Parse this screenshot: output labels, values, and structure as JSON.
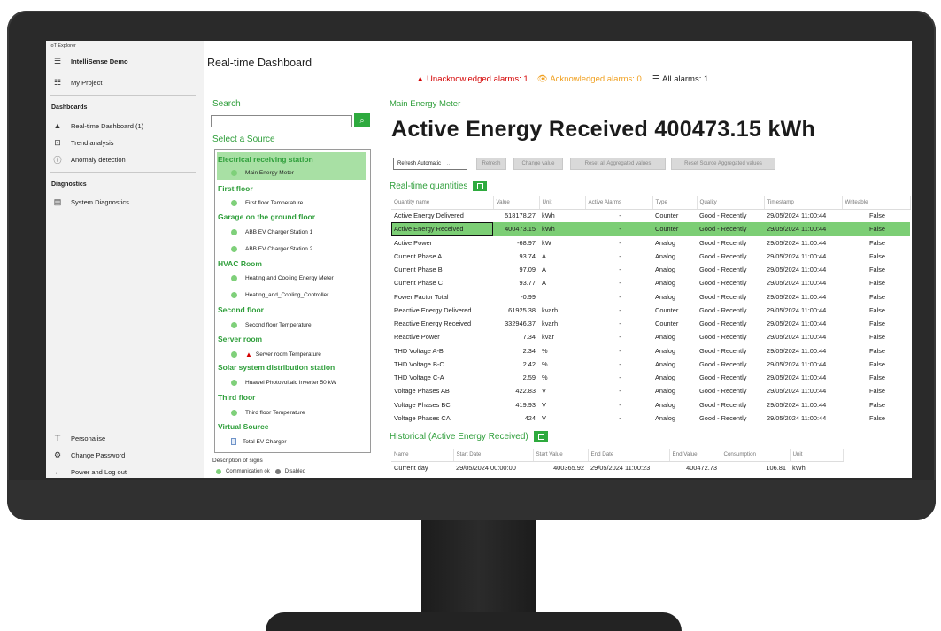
{
  "app": {
    "title": "IoT Explorer",
    "project_name": "IntelliSense Demo",
    "my_project": "My Project"
  },
  "nav": {
    "dashboards_header": "Dashboards",
    "dashboards": [
      {
        "label": "Real-time Dashboard (1)",
        "icon": "warning-icon"
      },
      {
        "label": "Trend analysis",
        "icon": "trend-icon"
      },
      {
        "label": "Anomaly detection",
        "icon": "alert-circle-icon"
      }
    ],
    "diagnostics_header": "Diagnostics",
    "diagnostics": [
      {
        "label": "System Diagnostics",
        "icon": "diagnostics-icon"
      }
    ],
    "bottom": [
      {
        "label": "Personalise",
        "icon": "personalise-icon"
      },
      {
        "label": "Change Password",
        "icon": "gear-icon"
      },
      {
        "label": "Power and Log out",
        "icon": "back-arrow-icon"
      }
    ]
  },
  "page": {
    "title": "Real-time Dashboard"
  },
  "alarms": {
    "unack": "Unacknowledged alarms: 1",
    "ack": "Acknowledged alarms: 0",
    "all": "All alarms: 1"
  },
  "sources": {
    "search_label": "Search",
    "search_value": "",
    "select_label": "Select a Source",
    "groups": [
      {
        "name": "Electrical receiving station",
        "items": [
          "Main Energy Meter"
        ]
      },
      {
        "name": "First floor",
        "items": [
          "First floor Temperature"
        ]
      },
      {
        "name": "Garage on the ground floor",
        "items": [
          "ABB EV Charger Station 1",
          "ABB EV Charger Station 2"
        ]
      },
      {
        "name": "HVAC Room",
        "items": [
          "Heating and Cooling Energy Meter",
          "Heating_and_Cooling_Controller"
        ]
      },
      {
        "name": "Second floor",
        "items": [
          "Second floor Temperature"
        ]
      },
      {
        "name": "Server room",
        "items": [
          "Server room Temperature"
        ]
      },
      {
        "name": "Solar system distribution station",
        "items": [
          "Huawei Photovoltaic Inverter 50 kW"
        ]
      },
      {
        "name": "Third floor",
        "items": [
          "Third floor Temperature"
        ]
      },
      {
        "name": "Virtual Source",
        "items": [
          "Total EV Charger"
        ]
      }
    ],
    "legend_title": "Description of signs",
    "legend_ok": "Communication ok",
    "legend_disabled": "Disabled"
  },
  "main": {
    "meter_label": "Main Energy Meter",
    "headline": "Active Energy Received 400473.15 kWh",
    "toolbar": {
      "refresh_mode": "Refresh Automatic",
      "refresh": "Refresh",
      "change_value": "Change value",
      "reset_all": "Reset all Aggregated values",
      "reset_source": "Reset Source Aggregated values"
    },
    "rt_title": "Real-time quantities",
    "rt_columns": [
      "Quantity name",
      "Value",
      "Unit",
      "Active Alarms",
      "Type",
      "Quality",
      "Timestamp",
      "Writeable"
    ],
    "rt_rows": [
      [
        "Active Energy Delivered",
        "518178.27",
        "kWh",
        "-",
        "Counter",
        "Good - Recently",
        "29/05/2024 11:00:44",
        "False"
      ],
      [
        "Active Energy Received",
        "400473.15",
        "kWh",
        "-",
        "Counter",
        "Good - Recently",
        "29/05/2024 11:00:44",
        "False"
      ],
      [
        "Active Power",
        "-68.97",
        "kW",
        "-",
        "Analog",
        "Good - Recently",
        "29/05/2024 11:00:44",
        "False"
      ],
      [
        "Current Phase A",
        "93.74",
        "A",
        "-",
        "Analog",
        "Good - Recently",
        "29/05/2024 11:00:44",
        "False"
      ],
      [
        "Current Phase B",
        "97.09",
        "A",
        "-",
        "Analog",
        "Good - Recently",
        "29/05/2024 11:00:44",
        "False"
      ],
      [
        "Current Phase C",
        "93.77",
        "A",
        "-",
        "Analog",
        "Good - Recently",
        "29/05/2024 11:00:44",
        "False"
      ],
      [
        "Power Factor Total",
        "-0.99",
        "",
        "-",
        "Analog",
        "Good - Recently",
        "29/05/2024 11:00:44",
        "False"
      ],
      [
        "Reactive Energy Delivered",
        "61925.38",
        "kvarh",
        "-",
        "Counter",
        "Good - Recently",
        "29/05/2024 11:00:44",
        "False"
      ],
      [
        "Reactive Energy Received",
        "332946.37",
        "kvarh",
        "-",
        "Counter",
        "Good - Recently",
        "29/05/2024 11:00:44",
        "False"
      ],
      [
        "Reactive Power",
        "7.34",
        "kvar",
        "-",
        "Analog",
        "Good - Recently",
        "29/05/2024 11:00:44",
        "False"
      ],
      [
        "THD Voltage A-B",
        "2.34",
        "%",
        "-",
        "Analog",
        "Good - Recently",
        "29/05/2024 11:00:44",
        "False"
      ],
      [
        "THD Voltage B-C",
        "2.42",
        "%",
        "-",
        "Analog",
        "Good - Recently",
        "29/05/2024 11:00:44",
        "False"
      ],
      [
        "THD Voltage C-A",
        "2.59",
        "%",
        "-",
        "Analog",
        "Good - Recently",
        "29/05/2024 11:00:44",
        "False"
      ],
      [
        "Voltage Phases AB",
        "422.83",
        "V",
        "-",
        "Analog",
        "Good - Recently",
        "29/05/2024 11:00:44",
        "False"
      ],
      [
        "Voltage Phases BC",
        "419.93",
        "V",
        "-",
        "Analog",
        "Good - Recently",
        "29/05/2024 11:00:44",
        "False"
      ],
      [
        "Voltage Phases CA",
        "424",
        "V",
        "-",
        "Analog",
        "Good - Recently",
        "29/05/2024 11:00:44",
        "False"
      ]
    ],
    "hist_title": "Historical (Active Energy Received)",
    "hist_columns": [
      "Name",
      "Start Date",
      "Start Value",
      "End Date",
      "End Value",
      "Consumption",
      "Unit"
    ],
    "hist_rows": [
      [
        "Current day",
        "29/05/2024 00:00:00",
        "400365.92",
        "29/05/2024 11:00:23",
        "400472.73",
        "106.81",
        "kWh"
      ]
    ]
  }
}
